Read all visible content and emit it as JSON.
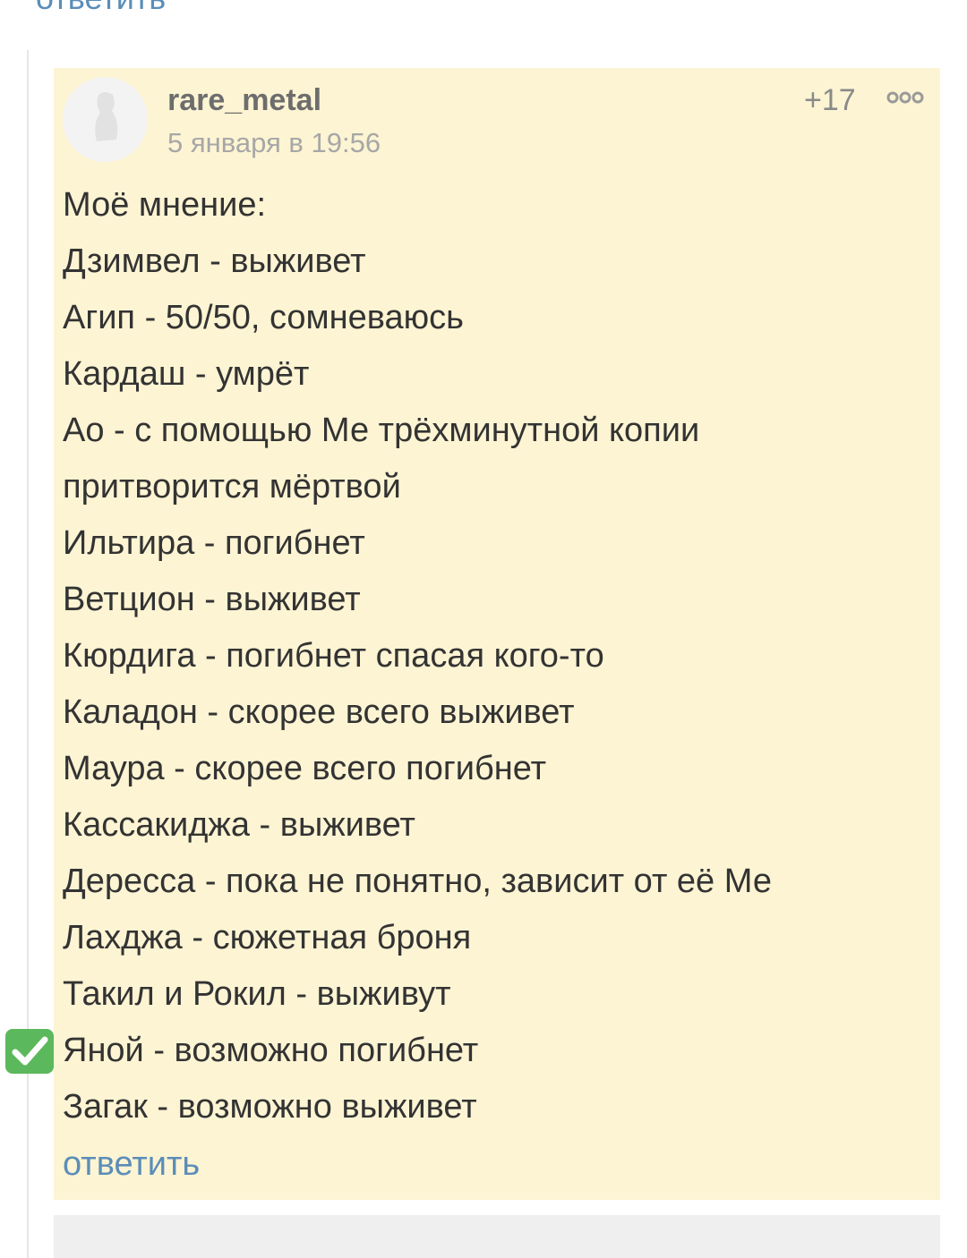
{
  "top_reply_label": "ответить",
  "comment": {
    "username": "rare_metal",
    "timestamp": "5 января в 19:56",
    "rating": "+17",
    "more_icon": "more-dots-icon",
    "lines": [
      "Моё мнение:",
      "Дзимвел - выживет",
      "Агип - 50/50, сомневаюсь",
      "Кардаш - умрёт",
      "Ао - с помощью Ме трёхминутной копии",
      "притворится мёртвой",
      "Ильтира - погибнет",
      "Ветцион - выживет",
      "Кюрдига - погибнет спасая кого-то",
      "Каладон - скорее всего выживет",
      "Маура - скорее всего погибнет",
      "Кассакиджа - выживет",
      "Дересса - пока не понятно, зависит от её Ме",
      "Лахджа - сюжетная броня",
      "Такил и Рокил - выживут",
      "Яной - возможно погибнет",
      "Загак - возможно выживет"
    ],
    "reply_label": "ответить"
  },
  "check_icon": "check-mark-icon",
  "colors": {
    "comment_background": "#fdf4d3",
    "link": "#5b8db8",
    "text": "#333333",
    "check_green": "#5cb85c"
  }
}
